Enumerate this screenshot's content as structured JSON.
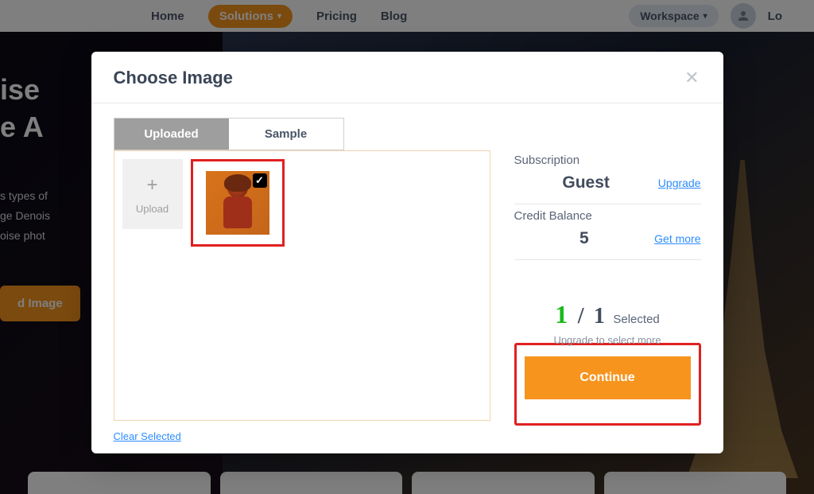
{
  "header": {
    "nav": {
      "home": "Home",
      "solutions": "Solutions",
      "pricing": "Pricing",
      "blog": "Blog"
    },
    "workspace": "Workspace",
    "login": "Lo"
  },
  "hero": {
    "title_line1": "ise",
    "title_line2": "e A",
    "desc_line1": "s types of",
    "desc_line2": "ge Denois",
    "desc_line3": "oise phot",
    "upload_btn": "d Image"
  },
  "modal": {
    "title": "Choose Image",
    "tabs": {
      "uploaded": "Uploaded",
      "sample": "Sample"
    },
    "upload_tile_label": "Upload",
    "clear_link": "Clear Selected",
    "subscription": {
      "label": "Subscription",
      "value": "Guest",
      "link": "Upgrade"
    },
    "credit": {
      "label": "Credit Balance",
      "value": "5",
      "link": "Get more"
    },
    "selected": {
      "count": "1",
      "total": "1",
      "label": "Selected",
      "hint": "Upgrade to select more"
    },
    "continue": "Continue"
  }
}
